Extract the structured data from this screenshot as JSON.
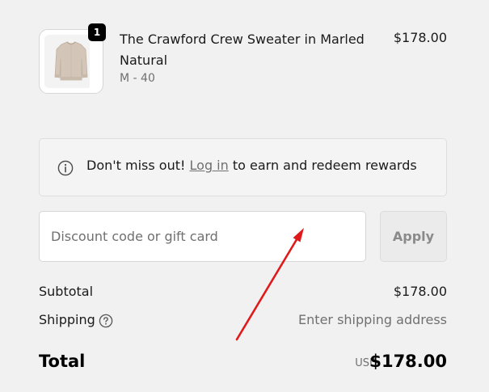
{
  "line_item": {
    "quantity": "1",
    "title": "The Crawford Crew Sweater in Marled Natural",
    "variant": "M - 40",
    "price": "$178.00"
  },
  "rewards_banner": {
    "text_before": "Don't miss out!",
    "link_label": "Log in",
    "text_after": "to earn and redeem rewards"
  },
  "discount": {
    "placeholder": "Discount code or gift card",
    "value": "",
    "apply_label": "Apply"
  },
  "summary": {
    "subtotal_label": "Subtotal",
    "subtotal_value": "$178.00",
    "shipping_label": "Shipping",
    "shipping_value": "Enter shipping address",
    "total_label": "Total",
    "currency": "USD",
    "total_value": "$178.00"
  },
  "icons": {
    "info": "info-circle-icon",
    "help": "question-circle-icon",
    "annotation": "red-arrow-annotation"
  },
  "colors": {
    "background": "#f1f1f1",
    "annotation_arrow": "#e01a1a",
    "muted_text": "#707070",
    "badge": "#000000"
  }
}
